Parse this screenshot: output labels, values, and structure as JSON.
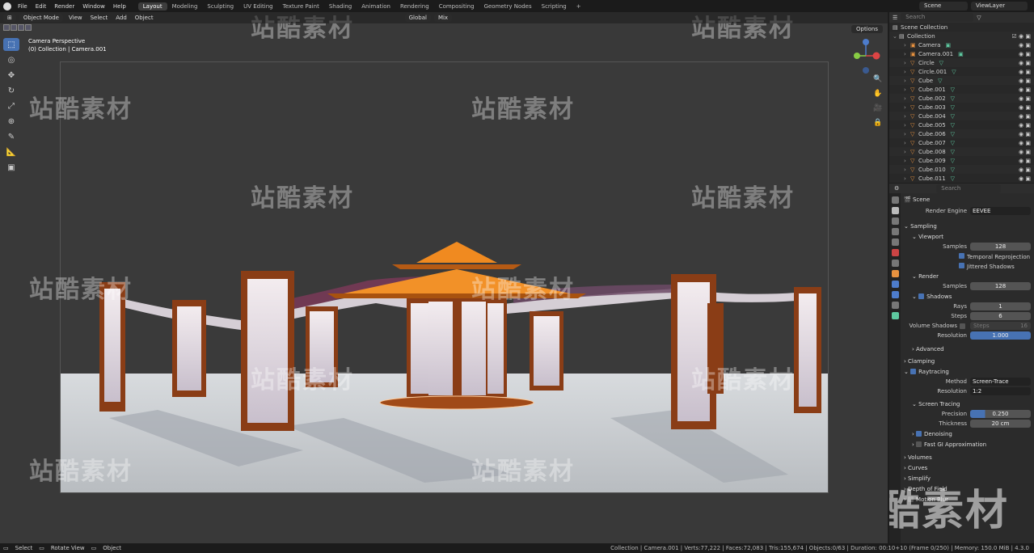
{
  "menu": [
    "File",
    "Edit",
    "Render",
    "Window",
    "Help"
  ],
  "workspaces": [
    {
      "label": "Layout",
      "active": true
    },
    {
      "label": "Modeling"
    },
    {
      "label": "Sculpting"
    },
    {
      "label": "UV Editing"
    },
    {
      "label": "Texture Paint"
    },
    {
      "label": "Shading"
    },
    {
      "label": "Animation"
    },
    {
      "label": "Rendering"
    },
    {
      "label": "Compositing"
    },
    {
      "label": "Geometry Nodes"
    },
    {
      "label": "Scripting"
    }
  ],
  "add_tab": "+",
  "scene_name": "Scene",
  "view_layer": "ViewLayer",
  "viewport": {
    "mode": "Object Mode",
    "menus": [
      "View",
      "Select",
      "Add",
      "Object"
    ],
    "transform": "Global",
    "snap_mix": "Mix",
    "options": "Options",
    "camera_label": "Camera Perspective",
    "collection_label": "(0) Collection | Camera.001"
  },
  "watermark": "站酷素材",
  "outliner": {
    "search_placeholder": "Search",
    "root": "Scene Collection",
    "collection": "Collection",
    "items": [
      "Camera",
      "Camera.001",
      "Circle",
      "Circle.001",
      "Cube",
      "Cube.001",
      "Cube.002",
      "Cube.003",
      "Cube.004",
      "Cube.005",
      "Cube.006",
      "Cube.007",
      "Cube.008",
      "Cube.009",
      "Cube.010",
      "Cube.011"
    ]
  },
  "properties": {
    "search_placeholder": "Search",
    "context": "Scene",
    "render_engine_label": "Render Engine",
    "render_engine": "EEVEE",
    "sampling": "Sampling",
    "viewport": "Viewport",
    "samples_label": "Samples",
    "viewport_samples": "128",
    "temporal_reprojection": "Temporal Reprojection",
    "jittered_shadows": "Jittered Shadows",
    "render": "Render",
    "render_samples": "128",
    "shadows": "Shadows",
    "rays_label": "Rays",
    "rays": "1",
    "steps_label": "Steps",
    "steps": "6",
    "volume_shadows": "Volume Shadows",
    "vs_steps_label": "Steps",
    "vs_steps": "16",
    "resolution_label": "Resolution",
    "shadow_resolution": "1.000",
    "advanced": "Advanced",
    "clamping": "Clamping",
    "raytracing": "Raytracing",
    "method_label": "Method",
    "method": "Screen-Trace",
    "rt_resolution": "1:2",
    "screen_tracing": "Screen Tracing",
    "precision_label": "Precision",
    "precision": "0.250",
    "thickness_label": "Thickness",
    "thickness": "20 cm",
    "denoising": "Denoising",
    "fast_gi": "Fast GI Approximation",
    "volumes": "Volumes",
    "curves": "Curves",
    "simplify": "Simplify",
    "dof": "Depth of Field",
    "motion_blur": "Motion Blur"
  },
  "status": {
    "select": "Select",
    "rotate": "Rotate View",
    "object": "Object",
    "stats": "Collection | Camera.001 | Verts:77,222 | Faces:72,083 | Tris:155,674 | Objects:0/63 | Duration: 00:10+10 (Frame 0/250) | Memory: 150.0 MiB | 4.3.0"
  },
  "colors": {
    "accent": "#4772b3",
    "roof": "#e88a22",
    "wood": "#8a3d16",
    "floor": "#cfd3d8"
  }
}
